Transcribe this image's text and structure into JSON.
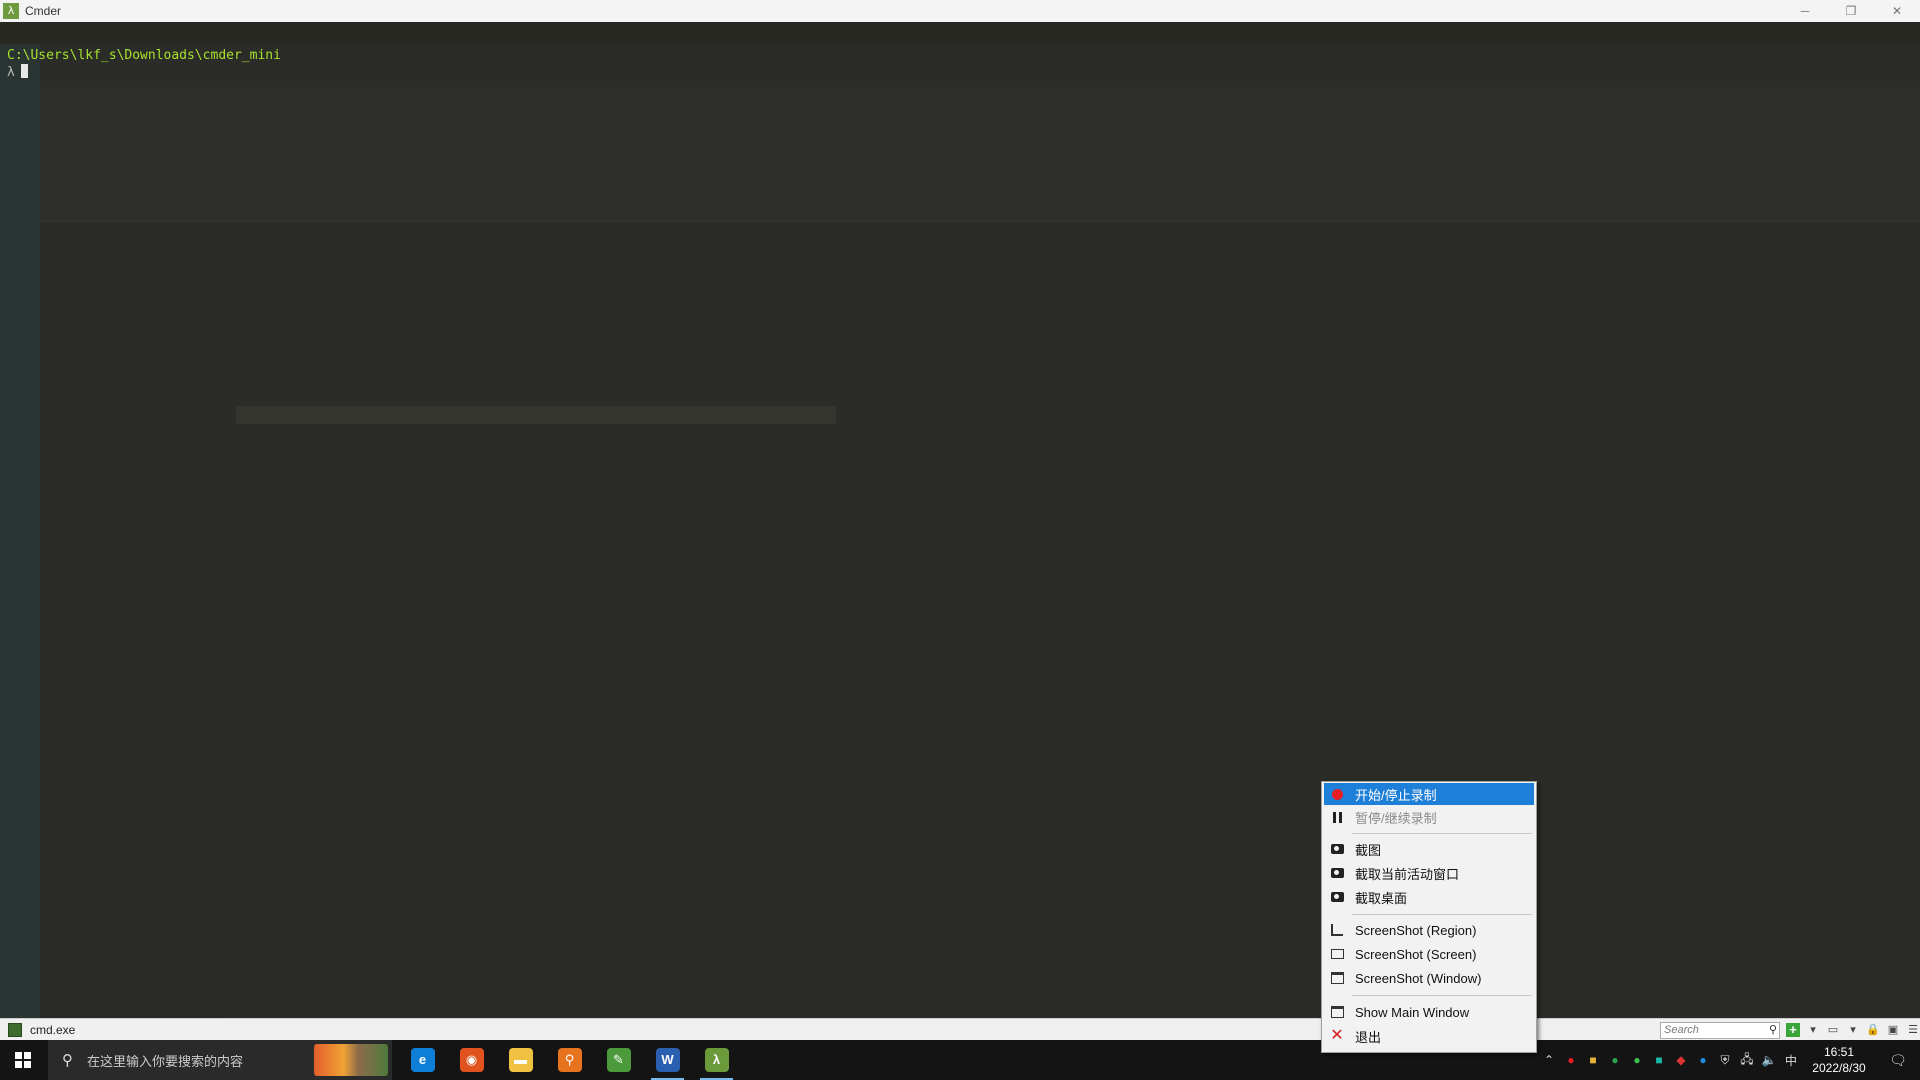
{
  "window": {
    "title": "Cmder",
    "controls": [
      "─",
      "❐",
      "✕"
    ]
  },
  "console": {
    "path_line": "C:\\Users\\lkf_s\\Downloads\\cmder_mini",
    "prompt_symbol": "λ"
  },
  "status_bar": {
    "tab_label": "cmd.exe",
    "search_placeholder": "Search"
  },
  "context_menu": {
    "items": [
      {
        "label": "开始/停止录制",
        "icon": "record-icon",
        "state": "highlighted"
      },
      {
        "label": "暂停/继续录制",
        "icon": "pause-icon",
        "state": "disabled"
      },
      {
        "label": "截图",
        "icon": "camera-icon",
        "state": "normal"
      },
      {
        "label": "截取当前活动窗口",
        "icon": "camera-icon",
        "state": "normal"
      },
      {
        "label": "截取桌面",
        "icon": "camera-icon",
        "state": "normal"
      },
      {
        "label": "ScreenShot (Region)",
        "icon": "crop-icon",
        "state": "normal"
      },
      {
        "label": "ScreenShot (Screen)",
        "icon": "monitor-icon",
        "state": "normal"
      },
      {
        "label": "ScreenShot (Window)",
        "icon": "window-icon",
        "state": "normal"
      },
      {
        "label": "Show Main Window",
        "icon": "window-icon",
        "state": "normal"
      },
      {
        "label": "退出",
        "icon": "close-red-icon",
        "state": "normal"
      }
    ],
    "colors": {
      "highlight": "#1e7fd8",
      "record": "#e81e25",
      "exit": "#d7191f"
    }
  },
  "taskbar": {
    "search_text": "在这里输入你要搜索的内容",
    "apps": [
      {
        "name": "edge-icon",
        "color": "#0f7ed6",
        "glyph": "e",
        "active": false
      },
      {
        "name": "ubuntu-icon",
        "color": "#e0531f",
        "glyph": "◉",
        "active": false
      },
      {
        "name": "file-explorer-icon",
        "color": "#f0c040",
        "glyph": "▬",
        "active": false
      },
      {
        "name": "search-tool-icon",
        "color": "#e8731e",
        "glyph": "⚲",
        "active": false
      },
      {
        "name": "notepad-icon",
        "color": "#4c9a3c",
        "glyph": "✎",
        "active": false
      },
      {
        "name": "word-icon",
        "color": "#2b5fb0",
        "glyph": "W",
        "active": true
      },
      {
        "name": "cmder-icon",
        "color": "#6b9a3a",
        "glyph": "λ",
        "active": true
      }
    ],
    "ime": "中",
    "time": "16:51",
    "date": "2022/8/30"
  }
}
